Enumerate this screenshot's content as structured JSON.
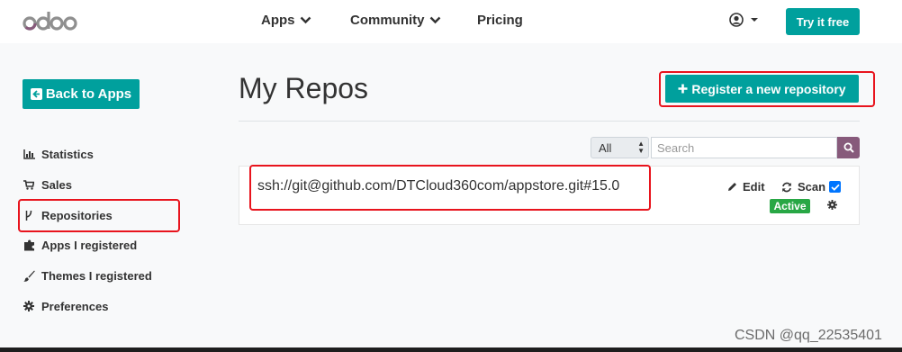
{
  "brand": {
    "logo_text": "odoo"
  },
  "nav": {
    "apps": "Apps",
    "community": "Community",
    "pricing": "Pricing",
    "try_label": "Try it free"
  },
  "sidebar": {
    "back_label": "Back to Apps",
    "items": [
      {
        "label": "Statistics",
        "icon": "bar-chart-icon"
      },
      {
        "label": "Sales",
        "icon": "cart-icon"
      },
      {
        "label": "Repositories",
        "icon": "branch-icon"
      },
      {
        "label": "Apps I registered",
        "icon": "puzzle-icon"
      },
      {
        "label": "Themes I registered",
        "icon": "paintbrush-icon"
      },
      {
        "label": "Preferences",
        "icon": "cog-icon"
      }
    ]
  },
  "main": {
    "title": "My Repos",
    "register_label": "Register a new repository",
    "filter": {
      "selected": "All"
    },
    "search": {
      "placeholder": "Search",
      "value": ""
    },
    "repos": [
      {
        "url": "ssh://git@github.com/DTCloud360com/appstore.git#15.0",
        "edit_label": "Edit",
        "scan_label": "Scan",
        "scan_checked": true,
        "status": "Active"
      }
    ]
  },
  "watermark": "CSDN @qq_22535401",
  "colors": {
    "accent": "#00a09d",
    "brand_purple": "#875a7b",
    "active_green": "#28a745",
    "highlight_red": "#e8141d"
  }
}
